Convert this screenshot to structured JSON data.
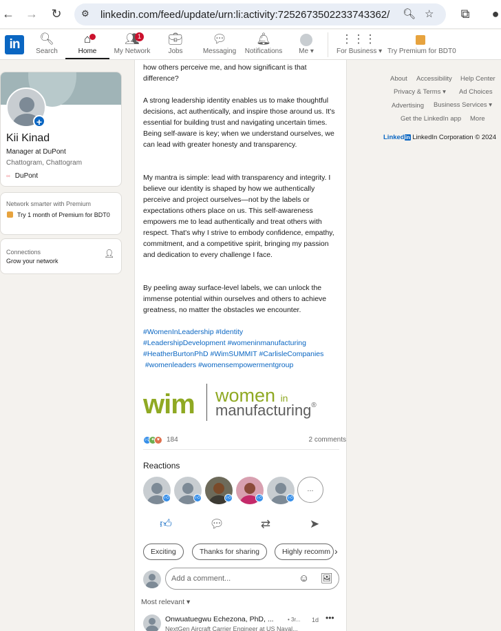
{
  "browser": {
    "url": "linkedin.com/feed/update/urn:li:activity:7252673502233743362/"
  },
  "nav": {
    "logo_text": "in",
    "items": [
      {
        "label": "Search"
      },
      {
        "label": "Home",
        "badge": ""
      },
      {
        "label": "My Network",
        "badge": "1"
      },
      {
        "label": "Jobs"
      },
      {
        "label": "Messaging"
      },
      {
        "label": "Notifications"
      },
      {
        "label": "Me"
      },
      {
        "label": "For Business"
      },
      {
        "label": "Try Premium for BDT0"
      }
    ]
  },
  "profile": {
    "name": "Kii Kinad",
    "title": "Manager at DuPont",
    "location": "Chattogram, Chattogram",
    "company": "DuPont"
  },
  "premium": {
    "teaser": "Network smarter with Premium",
    "link": "Try 1 month of Premium for BDT0"
  },
  "connections": {
    "title": "Connections",
    "subtitle": "Grow your network"
  },
  "post": {
    "top_line_1": "how others perceive me, and how significant is that",
    "top_line_2": "difference?",
    "paragraphs": [
      "A strong leadership identity enables us to make thoughtful decisions, act authentically, and inspire those around us. It's essential for building trust and navigating uncertain times. Being self-aware is key; when we understand ourselves, we can lead with greater honesty and transparency.",
      "My mantra is simple: lead with transparency and integrity. I believe our identity is shaped by how we authentically perceive and project ourselves—not by the labels or expectations others place on us. This self-awareness empowers me to lead authentically and treat others with respect. That's why I strive to embody confidence, empathy, commitment, and a competitive spirit, bringing my passion and dedication to every challenge I face.",
      "By peeling away surface-level labels, we can unlock the immense potential within ourselves and others to achieve greatness, no matter the obstacles we encounter."
    ],
    "hashtags": [
      "#WomenInLeadership #Identity",
      "#LeadershipDevelopment #womeninmanufacturing",
      "#HeatherBurtonPhD #WimSUMMIT #CarlisleCompanies",
      " #womenleaders #womensempowermentgroup"
    ],
    "image": {
      "wim": "wim",
      "line1_a": "women",
      "line1_b": "in",
      "line2": "manufacturing",
      "reg": "®"
    },
    "reaction_count": "184",
    "comments_count": "2 comments",
    "reactions_heading": "Reactions",
    "more_reactions": "...",
    "chips": [
      "Exciting",
      "Thanks for sharing",
      "Highly recomm"
    ],
    "comment_placeholder": "Add a comment...",
    "sort_label": "Most relevant",
    "comment": {
      "author": "Onwuatuegwu Echezona, PhD, ...",
      "degree": "• 3r...",
      "time": "1d",
      "headline": "NextGen Aircraft Carrier Engineer at US Naval..."
    }
  },
  "footer": {
    "links": [
      "About",
      "Accessibility",
      "Help Center",
      "Privacy & Terms",
      "Ad Choices",
      "Advertising",
      "Business Services",
      "Get the LinkedIn app",
      "More"
    ],
    "brand_a": "Linked",
    "brand_b": "in",
    "copyright": "LinkedIn Corporation © 2024"
  },
  "colors": {
    "brand": "#0a66c2",
    "notification": "#cb112d",
    "wim_green": "#8fa923"
  }
}
